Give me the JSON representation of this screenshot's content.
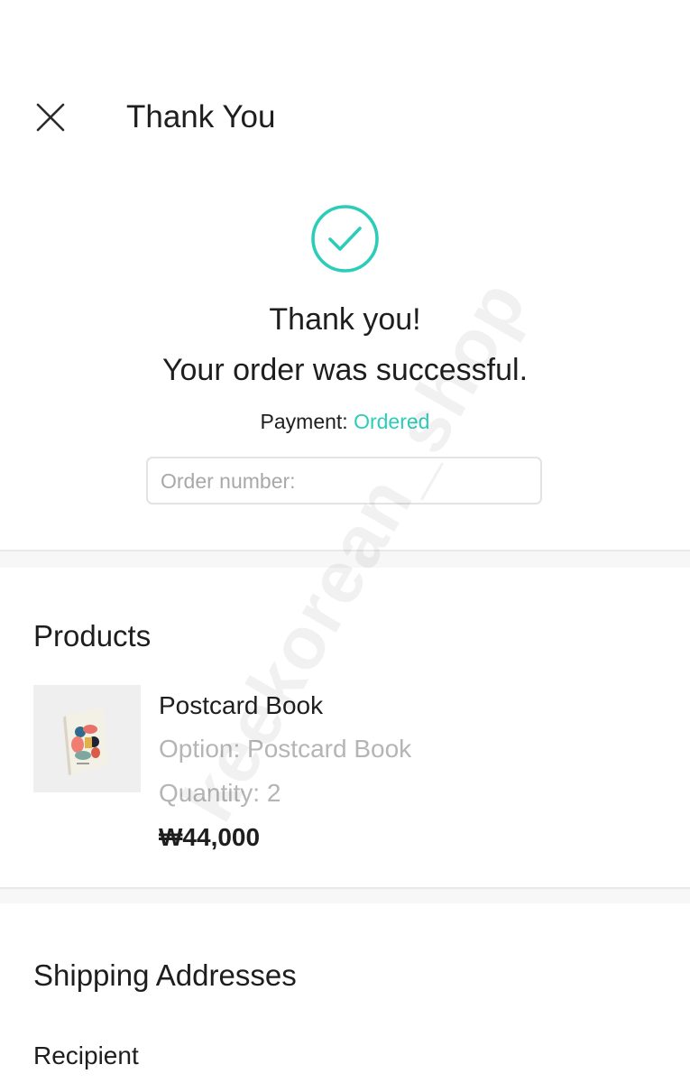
{
  "header": {
    "title": "Thank You",
    "close_icon": "close-icon"
  },
  "confirmation": {
    "icon": "check-circle-icon",
    "icon_color": "#2ccdb8",
    "line1": "Thank you!",
    "line2": "Your order was successful.",
    "payment_label": "Payment: ",
    "payment_status": "Ordered",
    "payment_status_color": "#2ccdb8",
    "order_number_placeholder": "Order number:"
  },
  "products": {
    "title": "Products",
    "items": [
      {
        "name": "Postcard Book",
        "option": "Option: Postcard Book",
        "quantity": "Quantity: 2",
        "price": "₩44,000"
      }
    ]
  },
  "shipping": {
    "title": "Shipping Addresses",
    "recipient_label": "Recipient"
  },
  "watermark": {
    "text": "keekorean_shop"
  }
}
